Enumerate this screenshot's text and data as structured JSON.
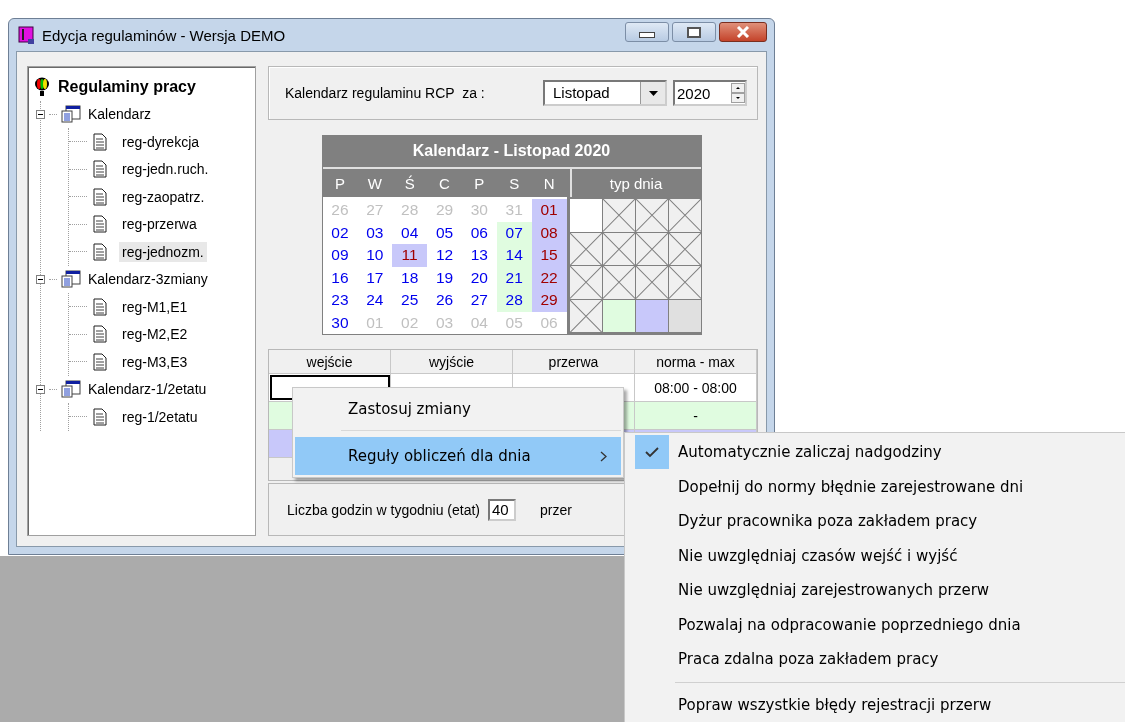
{
  "window": {
    "title": "Edycja regulaminów - Wersja DEMO"
  },
  "tree": {
    "root": "Regulaminy pracy",
    "groups": [
      {
        "label": "Kalendarz",
        "expanded": true,
        "children": [
          {
            "label": "reg-dyrekcja",
            "selected": false
          },
          {
            "label": "reg-jedn.ruch.",
            "selected": false
          },
          {
            "label": "reg-zaopatrz.",
            "selected": false
          },
          {
            "label": "reg-przerwa",
            "selected": false
          },
          {
            "label": "reg-jednozm.",
            "selected": true
          }
        ]
      },
      {
        "label": "Kalendarz-3zmiany",
        "expanded": true,
        "children": [
          {
            "label": "reg-M1,E1",
            "selected": false
          },
          {
            "label": "reg-M2,E2",
            "selected": false
          },
          {
            "label": "reg-M3,E3",
            "selected": false
          }
        ]
      },
      {
        "label": "Kalendarz-1/2etatu",
        "expanded": true,
        "children": [
          {
            "label": "reg-1/2etatu",
            "selected": false
          }
        ]
      }
    ]
  },
  "period": {
    "label": "Kalendarz regulaminu RCP  za :",
    "month": "Listopad",
    "year": "2020"
  },
  "calendar": {
    "title": "Kalendarz - Listopad 2020",
    "weekdays": [
      "P",
      "W",
      "Ś",
      "C",
      "P",
      "S",
      "N"
    ],
    "day_types_label": "typ dnia",
    "weeks": [
      [
        {
          "day": "26",
          "kind": "other"
        },
        {
          "day": "27",
          "kind": "other"
        },
        {
          "day": "28",
          "kind": "other"
        },
        {
          "day": "29",
          "kind": "other"
        },
        {
          "day": "30",
          "kind": "other"
        },
        {
          "day": "31",
          "kind": "other"
        },
        {
          "day": "01",
          "kind": "sunday"
        }
      ],
      [
        {
          "day": "02",
          "kind": "work"
        },
        {
          "day": "03",
          "kind": "work"
        },
        {
          "day": "04",
          "kind": "work"
        },
        {
          "day": "05",
          "kind": "work"
        },
        {
          "day": "06",
          "kind": "work"
        },
        {
          "day": "07",
          "kind": "saturday"
        },
        {
          "day": "08",
          "kind": "sunday"
        }
      ],
      [
        {
          "day": "09",
          "kind": "work"
        },
        {
          "day": "10",
          "kind": "work"
        },
        {
          "day": "11",
          "kind": "holiday"
        },
        {
          "day": "12",
          "kind": "work"
        },
        {
          "day": "13",
          "kind": "work"
        },
        {
          "day": "14",
          "kind": "saturday"
        },
        {
          "day": "15",
          "kind": "sunday"
        }
      ],
      [
        {
          "day": "16",
          "kind": "work"
        },
        {
          "day": "17",
          "kind": "work"
        },
        {
          "day": "18",
          "kind": "work"
        },
        {
          "day": "19",
          "kind": "work"
        },
        {
          "day": "20",
          "kind": "work"
        },
        {
          "day": "21",
          "kind": "saturday"
        },
        {
          "day": "22",
          "kind": "sunday"
        }
      ],
      [
        {
          "day": "23",
          "kind": "work"
        },
        {
          "day": "24",
          "kind": "work"
        },
        {
          "day": "25",
          "kind": "work"
        },
        {
          "day": "26",
          "kind": "work"
        },
        {
          "day": "27",
          "kind": "work"
        },
        {
          "day": "28",
          "kind": "saturday"
        },
        {
          "day": "29",
          "kind": "sunday"
        }
      ],
      [
        {
          "day": "30",
          "kind": "work"
        },
        {
          "day": "01",
          "kind": "other"
        },
        {
          "day": "02",
          "kind": "other"
        },
        {
          "day": "03",
          "kind": "other"
        },
        {
          "day": "04",
          "kind": "other"
        },
        {
          "day": "05",
          "kind": "other"
        },
        {
          "day": "06",
          "kind": "other"
        }
      ]
    ],
    "day_types": [
      {
        "kind": "blank"
      },
      {
        "kind": "crossed"
      },
      {
        "kind": "crossed"
      },
      {
        "kind": "crossed"
      },
      {
        "kind": "crossed"
      },
      {
        "kind": "crossed"
      },
      {
        "kind": "crossed"
      },
      {
        "kind": "crossed"
      },
      {
        "kind": "crossed"
      },
      {
        "kind": "crossed"
      },
      {
        "kind": "crossed"
      },
      {
        "kind": "crossed"
      },
      {
        "kind": "crossed"
      },
      {
        "kind": "swatch",
        "color": "#e0fce0"
      },
      {
        "kind": "swatch",
        "color": "#c8c8fa"
      },
      {
        "kind": "swatch",
        "color": "#e0e0e0"
      }
    ]
  },
  "table": {
    "columns": [
      "wejście",
      "wyjście",
      "przerwa",
      "norma - max"
    ],
    "rows": [
      {
        "color": "#ffffff",
        "focused": true,
        "norma": "08:00 - 08:00"
      },
      {
        "color": "#e0fce0",
        "focused": false,
        "norma": "-"
      },
      {
        "color": "#c8c8fa",
        "focused": false
      }
    ]
  },
  "weekly": {
    "label": "Liczba godzin w tygodniu (etat)",
    "value": "40",
    "next_label": "przer"
  },
  "context_menu": {
    "items": [
      {
        "label": "Zastosuj zmiany",
        "highlighted": false,
        "submenu": false
      },
      {
        "label": "Reguły obliczeń dla dnia",
        "highlighted": true,
        "submenu": true
      }
    ]
  },
  "submenu": {
    "groups": [
      [
        {
          "label": "Automatycznie zaliczaj nadgodziny",
          "checked": true
        },
        {
          "label": "Dopełnij do normy błędnie zarejestrowane dni",
          "checked": false
        },
        {
          "label": "Dyżur pracownika poza zakładem pracy",
          "checked": false
        },
        {
          "label": "Nie uwzględniaj czasów wejść i wyjść",
          "checked": false
        },
        {
          "label": "Nie uwzględniaj zarejestrowanych przerw",
          "checked": false
        },
        {
          "label": "Pozwalaj na odpracowanie poprzedniego dnia",
          "checked": false
        },
        {
          "label": "Praca zdalna poza zakładem pracy",
          "checked": false
        }
      ],
      [
        {
          "label": "Popraw wszystkie błędy rejestracji przerw",
          "checked": false
        }
      ]
    ]
  }
}
